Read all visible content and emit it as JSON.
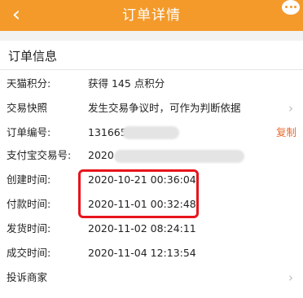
{
  "nav": {
    "title": "订单详情",
    "back_icon": "‹"
  },
  "section": {
    "title": "订单信息"
  },
  "rows": [
    {
      "label": "天猫积分:",
      "value": "获得 145 点积分"
    },
    {
      "label": "交易快照",
      "value": "发生交易争议时，可作为判断依据"
    },
    {
      "label": "订单编号:",
      "value": "131665",
      "action": "复制"
    },
    {
      "label": "支付宝交易号:",
      "value": "2020"
    },
    {
      "label": "创建时间:",
      "value": "2020-10-21 00:36:04"
    },
    {
      "label": "付款时间:",
      "value": "2020-11-01 00:32:48"
    },
    {
      "label": "发货时间:",
      "value": "2020-11-02 08:24:11"
    },
    {
      "label": "成交时间:",
      "value": "2020-11-04 12:13:54"
    },
    {
      "label": "投诉商家",
      "value": ""
    }
  ],
  "colors": {
    "nav_bg": "#f39a2b",
    "accent": "#e8692c",
    "highlight": "#e8141c"
  }
}
